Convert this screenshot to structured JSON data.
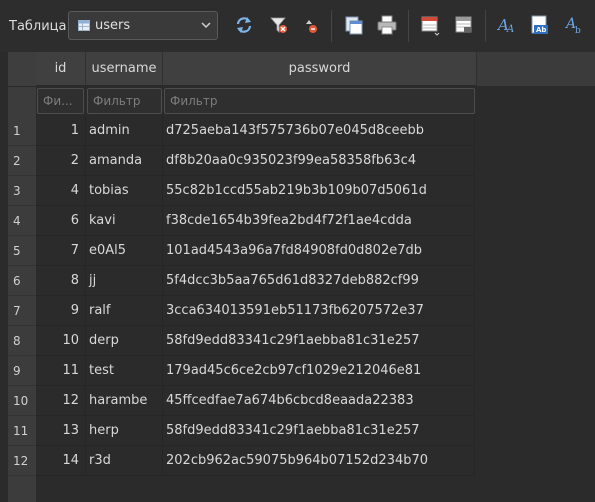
{
  "toolbar": {
    "table_label": "Таблица:",
    "selected_table": "users",
    "buttons": [
      {
        "name": "refresh-icon"
      },
      {
        "name": "clear-filter-icon"
      },
      {
        "name": "sort-icon"
      },
      {
        "name": "copy-icon"
      },
      {
        "name": "print-icon"
      },
      {
        "name": "insert-record-icon"
      },
      {
        "name": "delete-record-icon"
      },
      {
        "name": "font-icon"
      },
      {
        "name": "text-format-icon"
      },
      {
        "name": "highlight-icon"
      }
    ]
  },
  "grid": {
    "columns": [
      "id",
      "username",
      "password"
    ],
    "filter_placeholders": [
      "Фи...",
      "Фильтр",
      "Фильтр"
    ],
    "rows": [
      {
        "num": "1",
        "id": "1",
        "username": "admin",
        "password": "d725aeba143f575736b07e045d8ceebb"
      },
      {
        "num": "2",
        "id": "2",
        "username": "amanda",
        "password": "df8b20aa0c935023f99ea58358fb63c4"
      },
      {
        "num": "3",
        "id": "4",
        "username": "tobias",
        "password": "55c82b1ccd55ab219b3b109b07d5061d"
      },
      {
        "num": "4",
        "id": "6",
        "username": "kavi",
        "password": "f38cde1654b39fea2bd4f72f1ae4cdda"
      },
      {
        "num": "5",
        "id": "7",
        "username": "e0Al5",
        "password": "101ad4543a96a7fd84908fd0d802e7db"
      },
      {
        "num": "6",
        "id": "8",
        "username": "jj",
        "password": "5f4dcc3b5aa765d61d8327deb882cf99"
      },
      {
        "num": "7",
        "id": "9",
        "username": "ralf",
        "password": "3cca634013591eb51173fb6207572e37"
      },
      {
        "num": "8",
        "id": "10",
        "username": "derp",
        "password": "58fd9edd83341c29f1aebba81c31e257"
      },
      {
        "num": "9",
        "id": "11",
        "username": "test",
        "password": "179ad45c6ce2cb97cf1029e212046e81"
      },
      {
        "num": "10",
        "id": "12",
        "username": "harambe",
        "password": "45ffcedfae7a674b6cbcd8eaada22383"
      },
      {
        "num": "11",
        "id": "13",
        "username": "herp",
        "password": "58fd9edd83341c29f1aebba81c31e257"
      },
      {
        "num": "12",
        "id": "14",
        "username": "r3d",
        "password": "202cb962ac59075b964b07152d234b70"
      }
    ]
  }
}
